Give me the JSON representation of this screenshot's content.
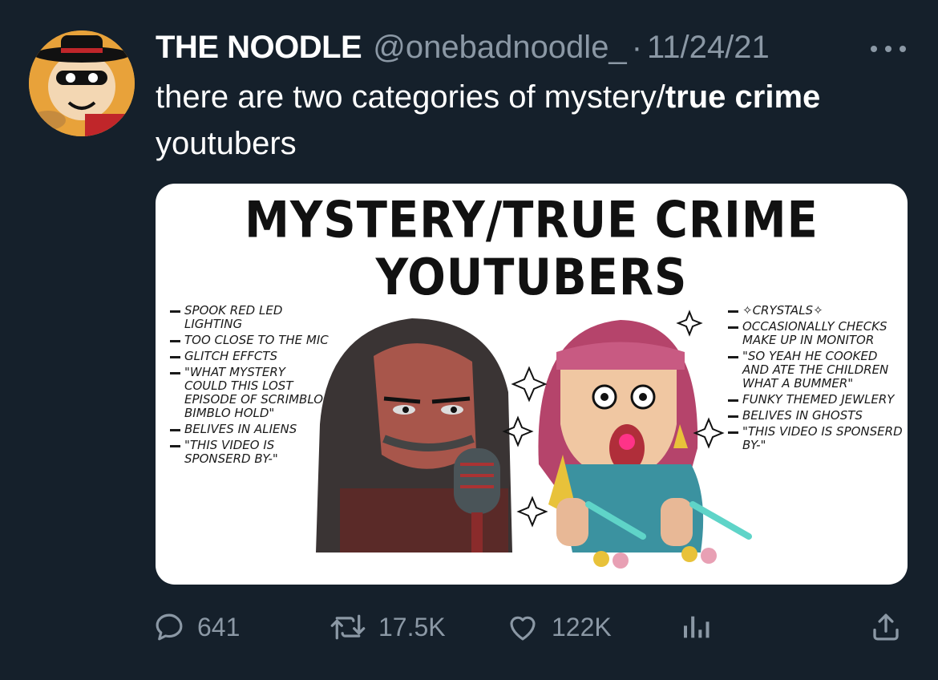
{
  "tweet": {
    "author_name": "THE NOODLE",
    "handle": "@onebadnoodle_",
    "separator": "·",
    "date": "11/24/21",
    "text_before": "there are two categories of mystery/",
    "text_bold1": "true",
    "text_space": " ",
    "text_bold2": "crime",
    "text_after": " youtubers"
  },
  "media": {
    "title_line1": "MYSTERY/TRUE CRIME",
    "title_line2": "YOUTUBERS",
    "left_notes": [
      "Spook red led lighting",
      "Too close to the mic",
      "Glitch effcts",
      "\"What mystery could this lost episode of scrimblo bimblo hold\"",
      "Belives in aliens",
      "\"This video is sponserd by-\""
    ],
    "right_notes": [
      "✧Crystals✧",
      "Occasionally checks make up in monitor",
      "\"So yeah he cooked and ate the children what a bummer\"",
      "Funky themed jewlery",
      "Belives in ghosts",
      "\"This video is sponserd by-\""
    ]
  },
  "actions": {
    "replies": "641",
    "retweets": "17.5K",
    "likes": "122K"
  },
  "colors": {
    "background": "#15202b",
    "muted": "#8b98a5",
    "text": "#ffffff",
    "card": "#ffffff"
  },
  "icons": [
    "more-icon",
    "reply-icon",
    "retweet-icon",
    "like-icon",
    "analytics-icon",
    "share-icon"
  ]
}
